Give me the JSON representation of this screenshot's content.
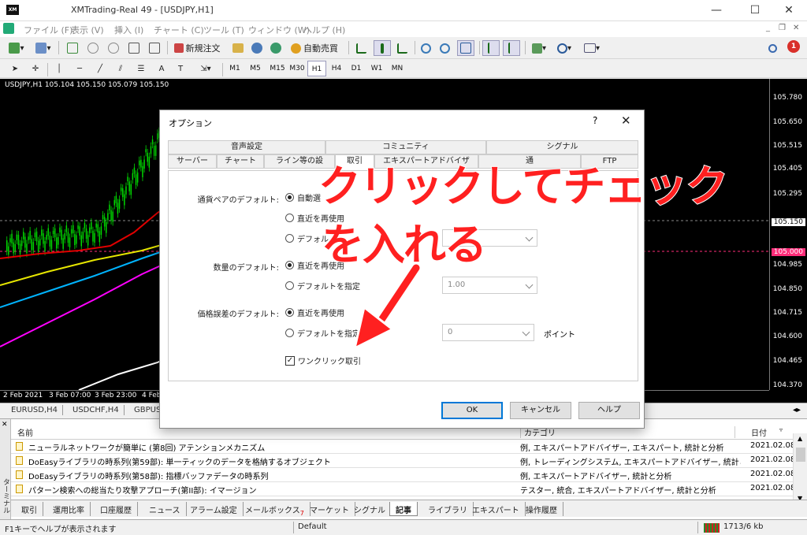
{
  "window": {
    "title": "XMTrading-Real 49 - [USDJPY,H1]",
    "logo": "XM",
    "min": "—",
    "max": "☐",
    "close": "✕"
  },
  "menu": [
    "ファイル (F)",
    "表示 (V)",
    "挿入 (I)",
    "チャート (C)",
    "ツール (T)",
    "ウィンドウ (W)",
    "ヘルプ (H)"
  ],
  "toolbar": {
    "new_order": "新規注文",
    "auto_trade": "自動売買"
  },
  "timeframes": [
    "M1",
    "M5",
    "M15",
    "M30",
    "H1",
    "H4",
    "D1",
    "W1",
    "MN"
  ],
  "active_timeframe": "H1",
  "chart": {
    "label": "USDJPY,H1  105.104 105.150 105.079 105.150",
    "price_ticks": [
      "105.780",
      "105.650",
      "105.515",
      "105.405",
      "105.295",
      "105.150",
      "105.000",
      "104.985",
      "104.850",
      "104.715",
      "104.600",
      "104.465",
      "104.370"
    ],
    "date_ticks": [
      "2 Feb 2021",
      "3 Feb 07:00",
      "3 Feb 23:00",
      "4 Feb"
    ],
    "colors": {
      "ma_red": "#e00000",
      "ma_yellow": "#e6e600",
      "ma_cyan": "#00b4ff",
      "ma_magenta": "#ff00ff",
      "ma_white": "#ffffff",
      "candles": "#00d800"
    }
  },
  "chart_tabs": [
    "EURUSD,H4",
    "USDCHF,H4",
    "GBPUS"
  ],
  "terminal": {
    "side_label": "ターミナル",
    "headers": {
      "name": "名前",
      "category": "カテゴリ",
      "date": "日付"
    },
    "rows": [
      {
        "name": "ニューラルネットワークが簡単に (第8回) アテンションメカニズム",
        "category": "例, エキスパートアドバイザー, エキスパート, 統計と分析",
        "date": "2021.02.08"
      },
      {
        "name": "DoEasyライブラリの時系列(第59部): 単一ティックのデータを格納するオブジェクト",
        "category": "例, トレーディングシステム, エキスパートアドバイザー, 統計と分析",
        "date": "2021.02.08"
      },
      {
        "name": "DoEasyライブラリの時系列(第58部): 指標バッファデータの時系列",
        "category": "例, エキスパートアドバイザー, 統計と分析",
        "date": "2021.02.08"
      },
      {
        "name": "パターン検索への総当たり攻撃アプローチ(第II部): イマージョン",
        "category": "テスター, 統合, エキスパートアドバイザー, 統計と分析",
        "date": "2021.02.08"
      }
    ],
    "tabs": [
      "取引",
      "運用比率",
      "口座履歴",
      "ニュース",
      "アラーム設定",
      "メールボックス",
      "マーケット",
      "シグナル",
      "記事",
      "ライブラリ",
      "エキスパート",
      "操作履歴"
    ],
    "mailbox_badge": "7",
    "active_tab": "記事"
  },
  "status": {
    "help": "F1キーでヘルプが表示されます",
    "profile": "Default",
    "traffic": "1713/6 kb"
  },
  "dialog": {
    "title": "オプション",
    "help": "?",
    "close": "✕",
    "tabs_row1": [
      "音声設定",
      "コミュニティ",
      "シグナル"
    ],
    "tabs_row2": [
      "サーバー",
      "チャート",
      "ライン等の設",
      "取引",
      "エキスパートアドバイザ",
      "通",
      "FTP"
    ],
    "symbol_label": "通貨ペアのデフォルト:",
    "symbol_opts": [
      "自動選",
      "直近を再使用",
      "デフォル"
    ],
    "volume_label": "数量のデフォルト:",
    "volume_opts": [
      "直近を再使用",
      "デフォルトを指定"
    ],
    "volume_value": "1.00",
    "deviation_label": "価格誤差のデフォルト:",
    "deviation_opts": [
      "直近を再使用",
      "デフォルトを指定"
    ],
    "deviation_value": "0",
    "deviation_unit": "ポイント",
    "one_click": "ワンクリック取引",
    "one_click_checked": "✓",
    "ok": "OK",
    "cancel": "キャンセル",
    "help_btn": "ヘルプ"
  },
  "annotation": {
    "line1": "クリックしてチェック",
    "line2": "を入れる",
    "color": "#ff2020"
  }
}
